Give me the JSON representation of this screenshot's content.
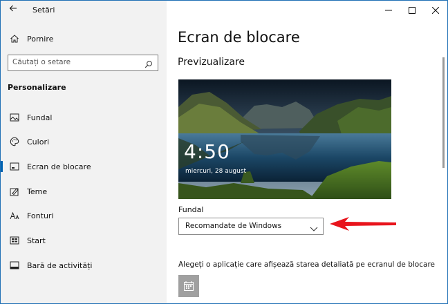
{
  "window": {
    "title": "Setări"
  },
  "sidebar": {
    "home_label": "Pornire",
    "search_placeholder": "Căutați o setare",
    "section_title": "Personalizare",
    "items": [
      {
        "label": "Fundal",
        "icon": "image-icon"
      },
      {
        "label": "Culori",
        "icon": "palette-icon"
      },
      {
        "label": "Ecran de blocare",
        "icon": "lock-screen-icon",
        "active": true
      },
      {
        "label": "Teme",
        "icon": "themes-icon"
      },
      {
        "label": "Fonturi",
        "icon": "font-icon"
      },
      {
        "label": "Start",
        "icon": "start-icon"
      },
      {
        "label": "Bară de activități",
        "icon": "taskbar-icon"
      }
    ]
  },
  "main": {
    "title": "Ecran de blocare",
    "preview_heading": "Previzualizare",
    "preview": {
      "time": "4:50",
      "date": "miercuri, 28 august"
    },
    "background_label": "Fundal",
    "background_value": "Recomandate de Windows",
    "apps_label": "Alegeți o aplicație care afișează starea detaliată pe ecranul de blocare"
  },
  "colors": {
    "accent": "#0063b1",
    "annotation_arrow": "#e8141c",
    "sidebar_bg": "#f2f2f2"
  }
}
